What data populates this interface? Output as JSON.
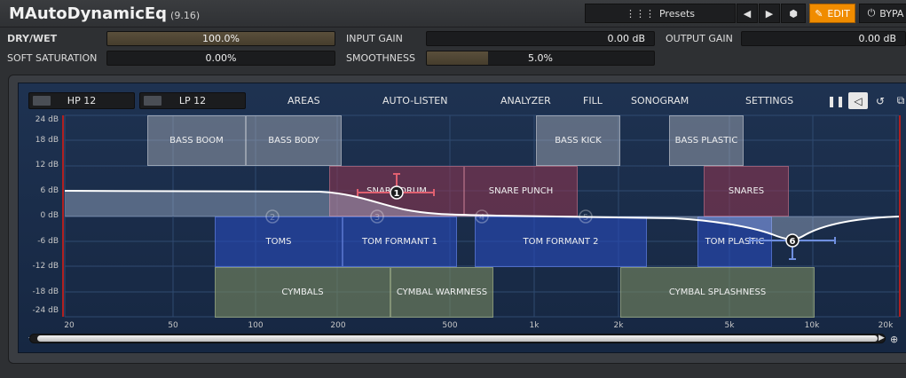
{
  "app": {
    "title": "MAutoDynamicEq",
    "version": "(9.16)"
  },
  "toolbar": {
    "presets_label": "Presets",
    "edit_label": "EDIT",
    "bypass_label": "BYPA"
  },
  "params": {
    "dry_wet": {
      "label": "DRY/WET",
      "value": "100.0%",
      "level": 1.0
    },
    "input_gain": {
      "label": "INPUT GAIN",
      "value": "0.00 dB",
      "level": 0.0
    },
    "output_gain": {
      "label": "OUTPUT GAIN",
      "value": "0.00 dB",
      "level": 0.0
    },
    "soft_saturation": {
      "label": "SOFT SATURATION",
      "value": "0.00%",
      "level": 0.0
    },
    "smoothness": {
      "label": "SMOOTHNESS",
      "value": "5.0%",
      "level": 0.27
    }
  },
  "eq_menu": {
    "hp": "HP 12",
    "lp": "LP 12",
    "items": [
      "AREAS",
      "AUTO-LISTEN",
      "ANALYZER",
      "FILL",
      "SONOGRAM",
      "SETTINGS"
    ]
  },
  "y_axis": [
    "24 dB",
    "18 dB",
    "12 dB",
    "6 dB",
    "0 dB",
    "-6 dB",
    "-12 dB",
    "-18 dB",
    "-24 dB"
  ],
  "x_axis": [
    "20",
    "50",
    "100",
    "200",
    "500",
    "1k",
    "2k",
    "5k",
    "10k",
    "20k"
  ],
  "areas": [
    {
      "label": "BASS BOOM",
      "style": "grey"
    },
    {
      "label": "BASS BODY",
      "style": "grey"
    },
    {
      "label": "BASS KICK",
      "style": "grey"
    },
    {
      "label": "BASS PLASTIC",
      "style": "grey"
    },
    {
      "label": "SNARE DRUM",
      "style": "red"
    },
    {
      "label": "SNARE PUNCH",
      "style": "red"
    },
    {
      "label": "SNARES",
      "style": "red"
    },
    {
      "label": "TOMS",
      "style": "blue"
    },
    {
      "label": "TOM FORMANT 1",
      "style": "blue"
    },
    {
      "label": "TOM FORMANT 2",
      "style": "blue"
    },
    {
      "label": "TOM PLASTIC",
      "style": "blue"
    },
    {
      "label": "CYMBALS",
      "style": "olive"
    },
    {
      "label": "CYMBAL WARMNESS",
      "style": "olive"
    },
    {
      "label": "CYMBAL SPLASHNESS",
      "style": "olive"
    }
  ],
  "bands": [
    {
      "id": "1",
      "active": true
    },
    {
      "id": "2",
      "active": false
    },
    {
      "id": "3",
      "active": false
    },
    {
      "id": "4",
      "active": false
    },
    {
      "id": "5",
      "active": false
    },
    {
      "id": "6",
      "active": true
    }
  ],
  "colors": {
    "accent": "#f08c00",
    "curve": "#ffffff",
    "band_red": "#e06070",
    "band_blue": "#6f8fe0"
  }
}
